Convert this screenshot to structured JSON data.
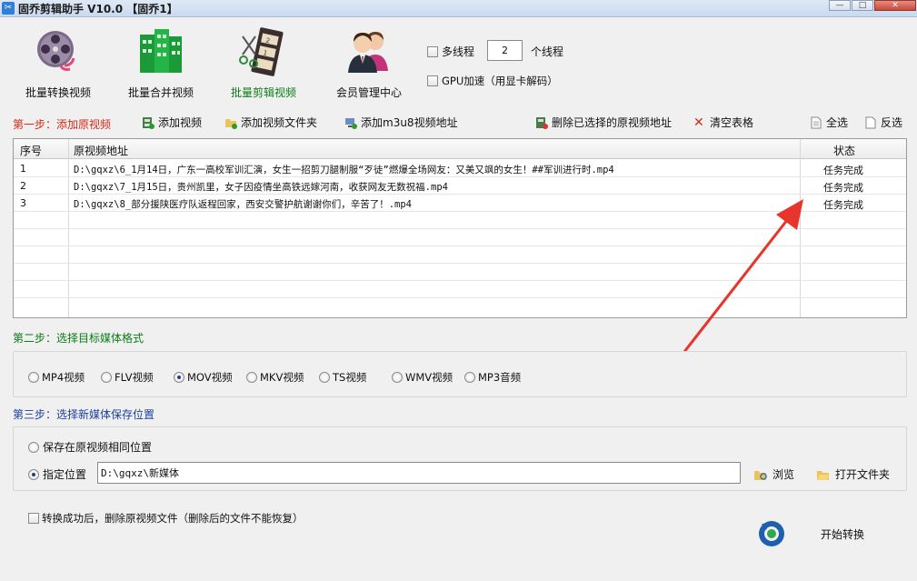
{
  "window": {
    "title": "固乔剪辑助手 V10.0 【固乔1】",
    "controls": [
      "minimize",
      "maximize",
      "close"
    ]
  },
  "toolbar": {
    "items": [
      {
        "label": "批量转换视频",
        "icon": "film-reel-convert-icon"
      },
      {
        "label": "批量合并视频",
        "icon": "building-merge-icon"
      },
      {
        "label": "批量剪辑视频",
        "icon": "film-strip-cut-icon",
        "active": true
      },
      {
        "label": "会员管理中心",
        "icon": "users-icon"
      }
    ],
    "multithread_label": "多线程",
    "thread_count": "2",
    "thread_unit": "个线程",
    "gpu_label": "GPU加速（用显卡解码）"
  },
  "step1": {
    "title": "第一步：添加原视频",
    "add_video": "添加视频",
    "add_folder": "添加视频文件夹",
    "add_m3u8": "添加m3u8视频地址",
    "delete_selected": "删除已选择的原视频地址",
    "clear_table": "清空表格",
    "select_all": "全选",
    "invert_select": "反选"
  },
  "table": {
    "columns": [
      "序号",
      "原视频地址",
      "状态"
    ],
    "rows": [
      {
        "index": "1",
        "path": "D:\\gqxz\\6_1月14日，广东一高校军训汇演，女生一招剪刀腿制服“歹徒”燃爆全场网友：又美又飒的女生！##军训进行时.mp4",
        "status": "任务完成"
      },
      {
        "index": "2",
        "path": "D:\\gqxz\\7_1月15日，贵州凯里，女子因疫情坐高铁远嫁河南，收获网友无数祝福.mp4",
        "status": "任务完成"
      },
      {
        "index": "3",
        "path": "D:\\gqxz\\8_部分援陕医疗队返程回家，西安交警护航谢谢你们，辛苦了！.mp4",
        "status": "任务完成"
      }
    ]
  },
  "step2": {
    "title": "第二步：选择目标媒体格式",
    "formats": [
      "MP4视频",
      "FLV视频",
      "MOV视频",
      "MKV视频",
      "TS视频",
      "WMV视频",
      "MP3音频"
    ],
    "selected": "MOV视频"
  },
  "step3": {
    "title": "第三步：选择新媒体保存位置",
    "same_location": "保存在原视频相同位置",
    "specify_location": "指定位置",
    "path_value": "D:\\gqxz\\新媒体",
    "browse": "浏览",
    "open_folder": "打开文件夹"
  },
  "footer": {
    "delete_after": "转换成功后，删除原视频文件（删除后的文件不能恢复）",
    "start": "开始转换"
  },
  "colors": {
    "step1": "#d42a1a",
    "step2": "#0a7d15",
    "step3": "#1a3fa0",
    "annotation_arrow": "#e8352b"
  }
}
